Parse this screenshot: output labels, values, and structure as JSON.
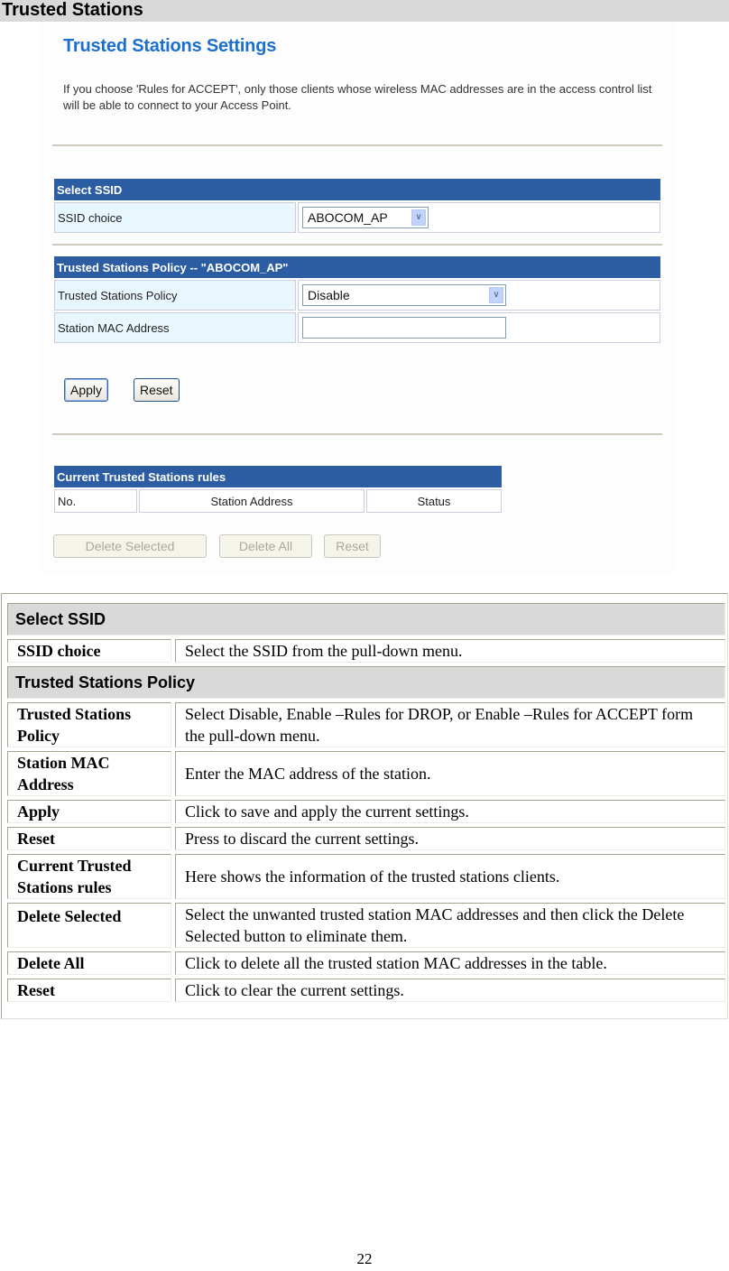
{
  "section_title": "Trusted Stations",
  "screenshot": {
    "title": "Trusted Stations Settings",
    "description": "If you choose 'Rules for ACCEPT', only those clients whose wireless MAC addresses are in the access control list will be able to connect to your Access Point.",
    "select_ssid": {
      "header": "Select SSID",
      "label": "SSID choice",
      "value": "ABOCOM_AP"
    },
    "policy": {
      "header": "Trusted Stations Policy -- \"ABOCOM_AP\"",
      "policy_label": "Trusted Stations Policy",
      "policy_value": "Disable",
      "mac_label": "Station MAC Address",
      "mac_value": ""
    },
    "buttons": {
      "apply": "Apply",
      "reset": "Reset"
    },
    "rules": {
      "header": "Current Trusted Stations rules",
      "columns": [
        "No.",
        "Station Address",
        "Status"
      ]
    },
    "rule_buttons": {
      "delete_selected": "Delete Selected",
      "delete_all": "Delete All",
      "reset": "Reset"
    }
  },
  "description_table": {
    "groups": [
      {
        "title": "Select SSID",
        "rows": [
          {
            "key": "SSID choice",
            "value": "Select the SSID from the pull-down menu."
          }
        ]
      },
      {
        "title": "Trusted Stations Policy",
        "rows": [
          {
            "key": "Trusted Stations Policy",
            "value": "Select Disable, Enable –Rules for DROP, or Enable –Rules for ACCEPT form the pull-down menu."
          },
          {
            "key": "Station MAC Address",
            "value": "Enter the MAC address of the station."
          },
          {
            "key": "Apply",
            "value": "Click to save and apply the current settings."
          },
          {
            "key": "Reset",
            "value": "Press to discard the current settings."
          },
          {
            "key": "Current Trusted Stations rules",
            "value": "Here shows the information of the trusted stations clients."
          },
          {
            "key": "Delete Selected",
            "value": "Select the unwanted trusted station MAC addresses and then click the Delete Selected button to eliminate them."
          },
          {
            "key": "Delete All",
            "value": "Click to delete all the trusted station MAC addresses in the table."
          },
          {
            "key": "Reset",
            "value": "Click to clear the current settings."
          }
        ]
      }
    ]
  },
  "page_number": "22"
}
